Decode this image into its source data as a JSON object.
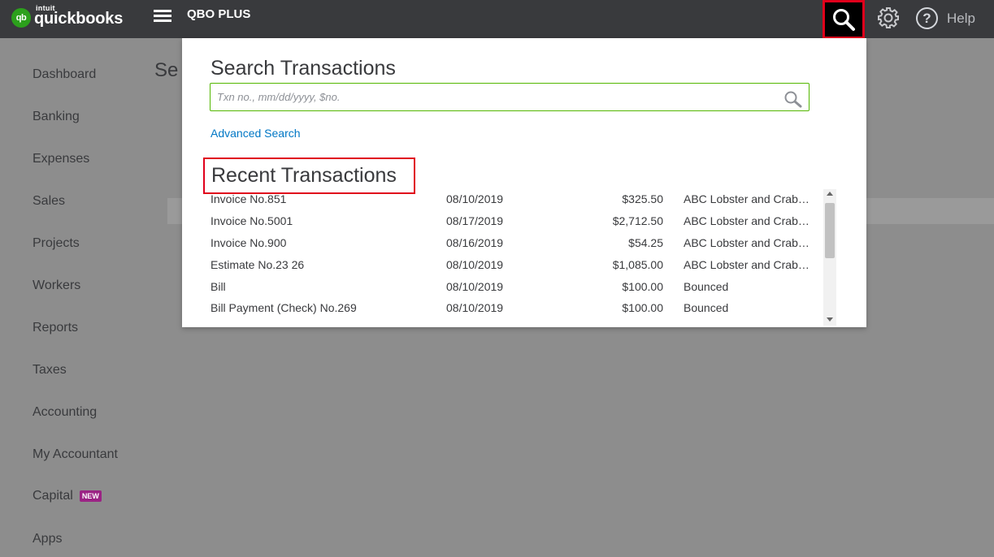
{
  "brand": {
    "intuit": "intuit",
    "name": "quickbooks",
    "badge": "qb"
  },
  "header": {
    "company": "QBO PLUS",
    "help_label": "Help"
  },
  "sidebar": {
    "items": [
      {
        "label": "Dashboard"
      },
      {
        "label": "Banking"
      },
      {
        "label": "Expenses"
      },
      {
        "label": "Sales"
      },
      {
        "label": "Projects"
      },
      {
        "label": "Workers"
      },
      {
        "label": "Reports"
      },
      {
        "label": "Taxes"
      },
      {
        "label": "Accounting"
      },
      {
        "label": "My Accountant"
      },
      {
        "label": "Capital",
        "badge": "NEW"
      },
      {
        "label": "Apps"
      }
    ]
  },
  "background": {
    "title_fragment": "Se"
  },
  "search_panel": {
    "title": "Search Transactions",
    "placeholder": "Txn no., mm/dd/yyyy, $no.",
    "advanced_link": "Advanced Search",
    "recent_title": "Recent Transactions",
    "transactions": [
      {
        "name": "Invoice No.851",
        "date": "08/10/2019",
        "amount": "$325.50",
        "payee": "ABC Lobster and Crab Co."
      },
      {
        "name": "Invoice No.5001",
        "date": "08/17/2019",
        "amount": "$2,712.50",
        "payee": "ABC Lobster and Crab Co."
      },
      {
        "name": "Invoice No.900",
        "date": "08/16/2019",
        "amount": "$54.25",
        "payee": "ABC Lobster and Crab Co."
      },
      {
        "name": "Estimate No.23 26",
        "date": "08/10/2019",
        "amount": "$1,085.00",
        "payee": "ABC Lobster and Crab Co."
      },
      {
        "name": "Bill",
        "date": "08/10/2019",
        "amount": "$100.00",
        "payee": "Bounced"
      },
      {
        "name": "Bill Payment (Check) No.269",
        "date": "08/10/2019",
        "amount": "$100.00",
        "payee": "Bounced"
      }
    ]
  },
  "colors": {
    "accent": "#2ca01c",
    "highlight": "#e0001b",
    "link": "#0077c5",
    "topbar": "#393a3d"
  }
}
